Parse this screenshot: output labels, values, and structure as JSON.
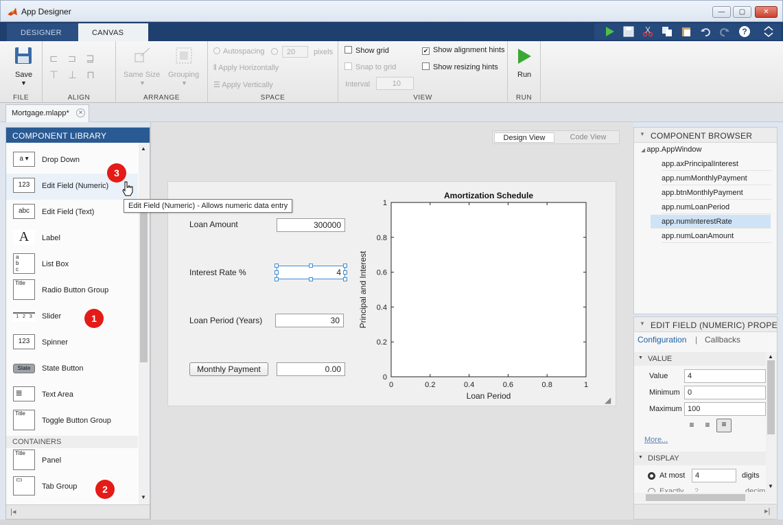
{
  "window": {
    "title": "App Designer",
    "minimize": "—",
    "maximize": "▢",
    "close": "✕"
  },
  "main_tabs": [
    {
      "label": "DESIGNER"
    },
    {
      "label": "CANVAS"
    }
  ],
  "ribbon": {
    "file": {
      "save_label": "Save",
      "section": "FILE"
    },
    "align": {
      "section": "ALIGN"
    },
    "arrange": {
      "same_size": "Same Size",
      "grouping": "Grouping",
      "section": "ARRANGE"
    },
    "space": {
      "autospacing": "Autospacing",
      "autospacing_value": "20",
      "pixels": "pixels",
      "apply_horizontally": "Apply Horizontally",
      "apply_vertically": "Apply Vertically",
      "section": "SPACE"
    },
    "view": {
      "show_grid": "Show grid",
      "snap_to_grid": "Snap to grid",
      "interval": "Interval",
      "interval_value": "10",
      "show_alignment_hints": "Show alignment hints",
      "show_resizing_hints": "Show resizing hints",
      "section": "VIEW"
    },
    "run": {
      "label": "Run",
      "section": "RUN"
    }
  },
  "document_tab": {
    "label": "Mortgage.mlapp*",
    "close": "×"
  },
  "component_library": {
    "title": "COMPONENT LIBRARY",
    "items": [
      {
        "icon": "a ▾",
        "label": "Drop Down"
      },
      {
        "icon": "123",
        "label": "Edit Field (Numeric)"
      },
      {
        "icon": "abc",
        "label": "Edit Field (Text)"
      },
      {
        "icon": "A",
        "label": "Label"
      },
      {
        "icon": "a b c",
        "label": "List Box"
      },
      {
        "icon": "Title",
        "label": "Radio Button Group"
      },
      {
        "icon": "1 2 3",
        "label": "Slider"
      },
      {
        "icon": "123",
        "label": "Spinner"
      },
      {
        "icon": "State",
        "label": "State Button"
      },
      {
        "icon": "≡",
        "label": "Text Area"
      },
      {
        "icon": "Title",
        "label": "Toggle Button Group"
      }
    ],
    "containers_header": "CONTAINERS",
    "containers": [
      {
        "icon": "Title",
        "label": "Panel"
      },
      {
        "icon": "▭",
        "label": "Tab Group"
      }
    ],
    "tooltip": "Edit Field (Numeric) - Allows numeric data entry"
  },
  "callouts": [
    "1",
    "2",
    "3"
  ],
  "view_toggle": {
    "design": "Design View",
    "code": "Code View"
  },
  "app": {
    "loan_amount_label": "Loan Amount",
    "loan_amount_value": "300000",
    "interest_rate_label": "Interest Rate %",
    "interest_rate_value": "4",
    "loan_period_label": "Loan Period (Years)",
    "loan_period_value": "30",
    "monthly_payment_button": "Monthly Payment",
    "monthly_payment_value": "0.00"
  },
  "chart_data": {
    "type": "line",
    "title": "Amortization Schedule",
    "xlabel": "Loan Period",
    "ylabel": "Principal and Interest",
    "xlim": [
      0,
      1
    ],
    "ylim": [
      0,
      1
    ],
    "xticks": [
      "0",
      "0.2",
      "0.4",
      "0.6",
      "0.8",
      "1"
    ],
    "yticks": [
      "0",
      "0.2",
      "0.4",
      "0.6",
      "0.8",
      "1"
    ],
    "series": []
  },
  "component_browser": {
    "title": "COMPONENT BROWSER",
    "root": "app.AppWindow",
    "items": [
      "app.axPrincipalInterest",
      "app.numMonthlyPayment",
      "app.btnMonthlyPayment",
      "app.numLoanPeriod",
      "app.numInterestRate",
      "app.numLoanAmount"
    ],
    "selected": "app.numInterestRate"
  },
  "inspector": {
    "title": "EDIT FIELD (NUMERIC) PROPERTIES",
    "tab_configuration": "Configuration",
    "tab_separator": "|",
    "tab_callbacks": "Callbacks",
    "value_group": "VALUE",
    "value_label": "Value",
    "value": "4",
    "minimum_label": "Minimum",
    "minimum": "0",
    "maximum_label": "Maximum",
    "maximum": "100",
    "more": "More...",
    "display_group": "DISPLAY",
    "at_most_label": "At most",
    "at_most_value": "4",
    "digits": "digits",
    "exactly_label": "Exactly",
    "exactly_value": "2",
    "decimals": "decima"
  },
  "colors": {
    "accent": "#2a5a93",
    "selected_row": "#cfe3f6",
    "badge": "#e41b17",
    "run_green": "#3aa835"
  }
}
